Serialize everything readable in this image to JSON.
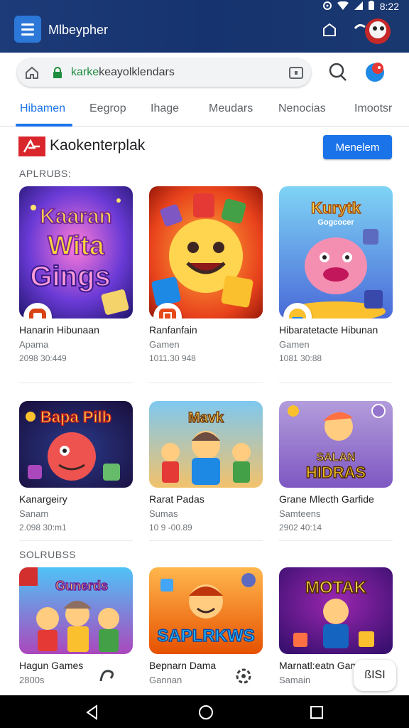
{
  "status_bar": {
    "time": "8:22"
  },
  "app": {
    "title": "Mlbeypher"
  },
  "address_bar": {
    "url_highlight": "karke",
    "url_rest": "keayolklendars"
  },
  "tabs": [
    {
      "label": "Hibamen"
    },
    {
      "label": "Eegrop"
    },
    {
      "label": "Ihage"
    },
    {
      "label": "Meudars"
    },
    {
      "label": "Nenocias"
    },
    {
      "label": "Imootsr"
    }
  ],
  "header": {
    "brand_name": "Kaokenterplak",
    "cta_label": "Menelem"
  },
  "sections": [
    {
      "label": "APLRUBS:"
    },
    {
      "label": "SOLRUBSS"
    }
  ],
  "cards": [
    {
      "title": "Hanarin Hibunaan",
      "subtitle": "Apama",
      "meta": "2098 30:449",
      "art": "Kaaran Wita Gings"
    },
    {
      "title": "Ranfanfain",
      "subtitle": "Gamen",
      "meta": "1011.30 948",
      "art": ""
    },
    {
      "title": "Hibaratetacte Hibunan",
      "subtitle": "Gamen",
      "meta": "1081 30:88",
      "art": "Kurytk Gogcocer"
    },
    {
      "title": "Kanargeiry",
      "subtitle": "Sanam",
      "meta": "2.098 30:m1",
      "art": "Bapa Pilb"
    },
    {
      "title": "Rarat Padas",
      "subtitle": "Sumas",
      "meta": "10 9 -00.89",
      "art": "Mavk"
    },
    {
      "title": "Grane Mlecth Garfide",
      "subtitle": "Samteens",
      "meta": "2902 40:14",
      "art": "Salan Hidras"
    },
    {
      "title": "Hagun Games",
      "subtitle": "2800s",
      "meta": "",
      "art": "Gunerds"
    },
    {
      "title": "Bepnarn Dama",
      "subtitle": "Gannan",
      "meta": "",
      "art": "Saplrkws"
    },
    {
      "title": "Marnatl:eatn Gama",
      "subtitle": "Samain",
      "meta": "",
      "art": "Motak"
    }
  ],
  "translate_button": {
    "label": "ßISI"
  },
  "colors": {
    "accent": "#1a73e8",
    "app_bar": "#1d3b78",
    "brand_red": "#d9262c"
  }
}
